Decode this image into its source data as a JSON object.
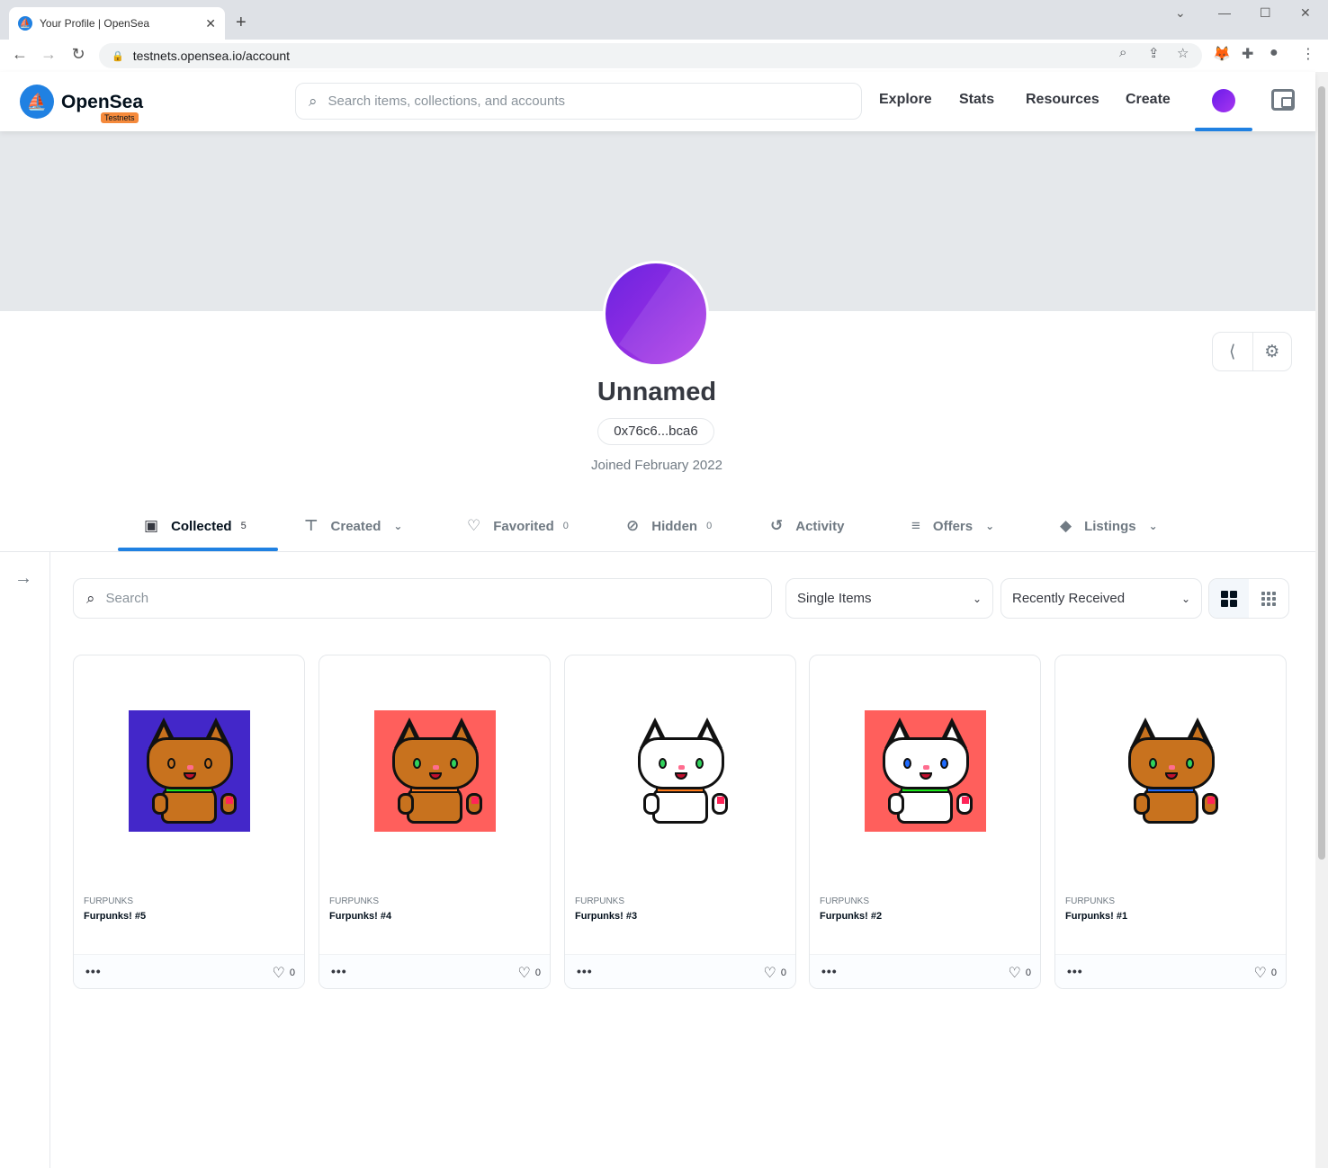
{
  "browser": {
    "tab_title": "Your Profile | OpenSea",
    "url": "testnets.opensea.io/account"
  },
  "header": {
    "brand": "OpenSea",
    "badge": "Testnets",
    "search_placeholder": "Search items, collections, and accounts",
    "nav": [
      "Explore",
      "Stats",
      "Resources",
      "Create"
    ]
  },
  "profile": {
    "name": "Unnamed",
    "address": "0x76c6...bca6",
    "joined": "Joined February 2022"
  },
  "tabs": [
    {
      "label": "Collected",
      "count": "5"
    },
    {
      "label": "Created"
    },
    {
      "label": "Favorited",
      "count": "0"
    },
    {
      "label": "Hidden",
      "count": "0"
    },
    {
      "label": "Activity"
    },
    {
      "label": "Offers"
    },
    {
      "label": "Listings"
    }
  ],
  "filters": {
    "search_placeholder": "Search",
    "item_type": "Single Items",
    "sort": "Recently Received"
  },
  "items": [
    {
      "collection": "FURPUNKS",
      "name": "Furpunks! #5",
      "likes": "0",
      "bg": "#4327c9",
      "fur": "#c8721e",
      "collar": "#1bea1b",
      "eye": "#c8721e"
    },
    {
      "collection": "FURPUNKS",
      "name": "Furpunks! #4",
      "likes": "0",
      "bg": "#ff5f5c",
      "fur": "#c8721e",
      "collar": "#ff7b1b",
      "eye": "#30d35c"
    },
    {
      "collection": "FURPUNKS",
      "name": "Furpunks! #3",
      "likes": "0",
      "bg": "#ffffff",
      "fur": "#ffffff",
      "collar": "#ff7b1b",
      "eye": "#30d35c"
    },
    {
      "collection": "FURPUNKS",
      "name": "Furpunks! #2",
      "likes": "0",
      "bg": "#ff5f5c",
      "fur": "#ffffff",
      "collar": "#1bea1b",
      "eye": "#1f6bff"
    },
    {
      "collection": "FURPUNKS",
      "name": "Furpunks! #1",
      "likes": "0",
      "bg": "#ffffff",
      "fur": "#c8721e",
      "collar": "#1f6bff",
      "eye": "#30d35c"
    }
  ],
  "colors": {
    "accent": "#2081e2",
    "banner": "#e5e8eb"
  }
}
